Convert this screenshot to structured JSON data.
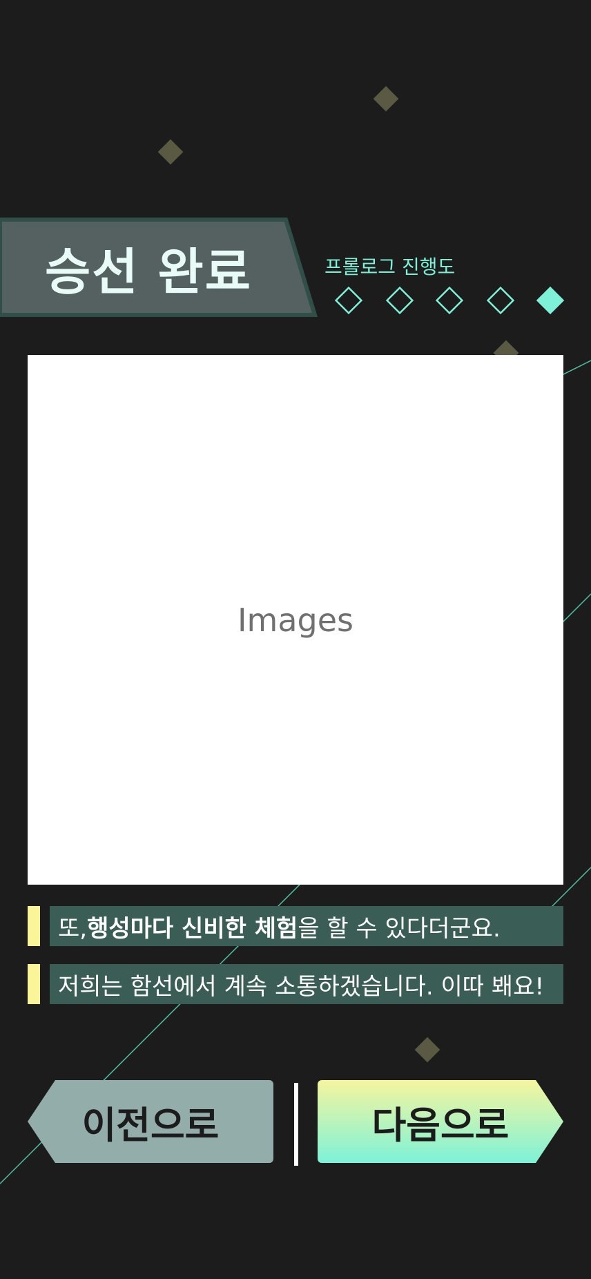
{
  "header": {
    "title": "승선 완료",
    "progress_label": "프롤로그 진행도",
    "progress": {
      "total": 5,
      "current": 5
    }
  },
  "image_panel": {
    "label": "Images"
  },
  "messages": [
    {
      "before": "또, ",
      "bold": "행성마다 신비한 체험",
      "after": "을 할 수 있다더군요."
    },
    {
      "text": "저희는 함선에서 계속 소통하겠습니다. 이따 봬요!"
    }
  ],
  "navigation": {
    "prev_label": "이전으로",
    "next_label": "다음으로"
  },
  "colors": {
    "accent": "#7ef2d8",
    "highlight": "#fbf59a",
    "banner": "#556060",
    "message_bg": "#3a5e56",
    "background": "#1c1c1c"
  }
}
